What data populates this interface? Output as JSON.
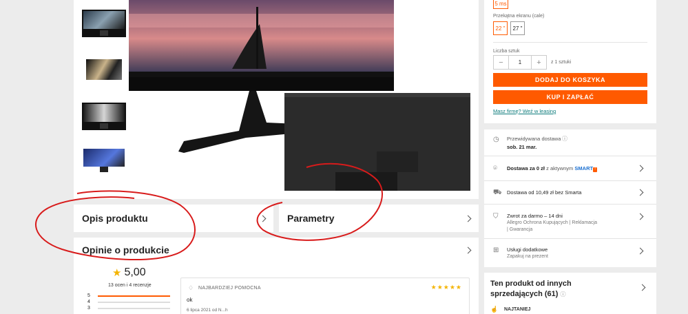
{
  "gallery": {
    "thumbnails": [
      "thumb-1",
      "thumb-2",
      "thumb-3",
      "thumb-4"
    ]
  },
  "sections": {
    "opis": "Opis produktu",
    "parametry": "Parametry",
    "opinie": "Opinie o produkcie"
  },
  "reviews": {
    "rating": "5,00",
    "summary": "13 ocen i 4 recenzje",
    "bars": [
      {
        "label": "5",
        "fill": 1.0
      },
      {
        "label": "4",
        "fill": 0.0
      },
      {
        "label": "3",
        "fill": 0.0
      }
    ],
    "featured": {
      "badge": "NAJBARDZIEJ POMOCNA",
      "text": "ok",
      "meta": "6 lipca 2021 od N...h",
      "stars": "★★★★★"
    }
  },
  "purchase": {
    "response_time": "5 ms",
    "screen_label": "Przekątna ekranu (cale)",
    "screen_options": [
      "22 \"",
      "27 \""
    ],
    "screen_selected": 0,
    "qty_label": "Liczba sztuk",
    "qty_value": "1",
    "qty_of": "z 1 sztuki",
    "minus": "−",
    "plus": "+",
    "add_to_cart": "DODAJ DO KOSZYKA",
    "buy_now": "KUP I ZAPŁAĆ",
    "leasing_link": "Masz firmę? Weź w leasing"
  },
  "delivery": {
    "expected_label": "Przewidywana dostawa",
    "expected_date": "sob. 21 mar.",
    "smart_text": "Dostawa za 0 zł",
    "smart_suffix": "z aktywnym",
    "smart_brand": "SMART",
    "smart_badge": "!",
    "no_smart": "Dostawa od 10,49 zł bez Smarta",
    "return_title": "Zwrot za darmo – 14 dni",
    "return_sub1": "Allegro Ochrona Kupujących | Reklamacja",
    "return_sub2": "| Gwarancja",
    "extras_title": "Usługi dodatkowe",
    "extras_sub": "Zapakuj na prezent"
  },
  "other_sellers": {
    "title_line1": "Ten produkt od innych",
    "title_line2": "sprzedających (61)",
    "cheapest": "NAJTANIEJ"
  },
  "colors": {
    "accent": "#ff5a00",
    "annotation": "#d81b1b",
    "link": "#0a7a7a",
    "star": "#f4b400"
  }
}
